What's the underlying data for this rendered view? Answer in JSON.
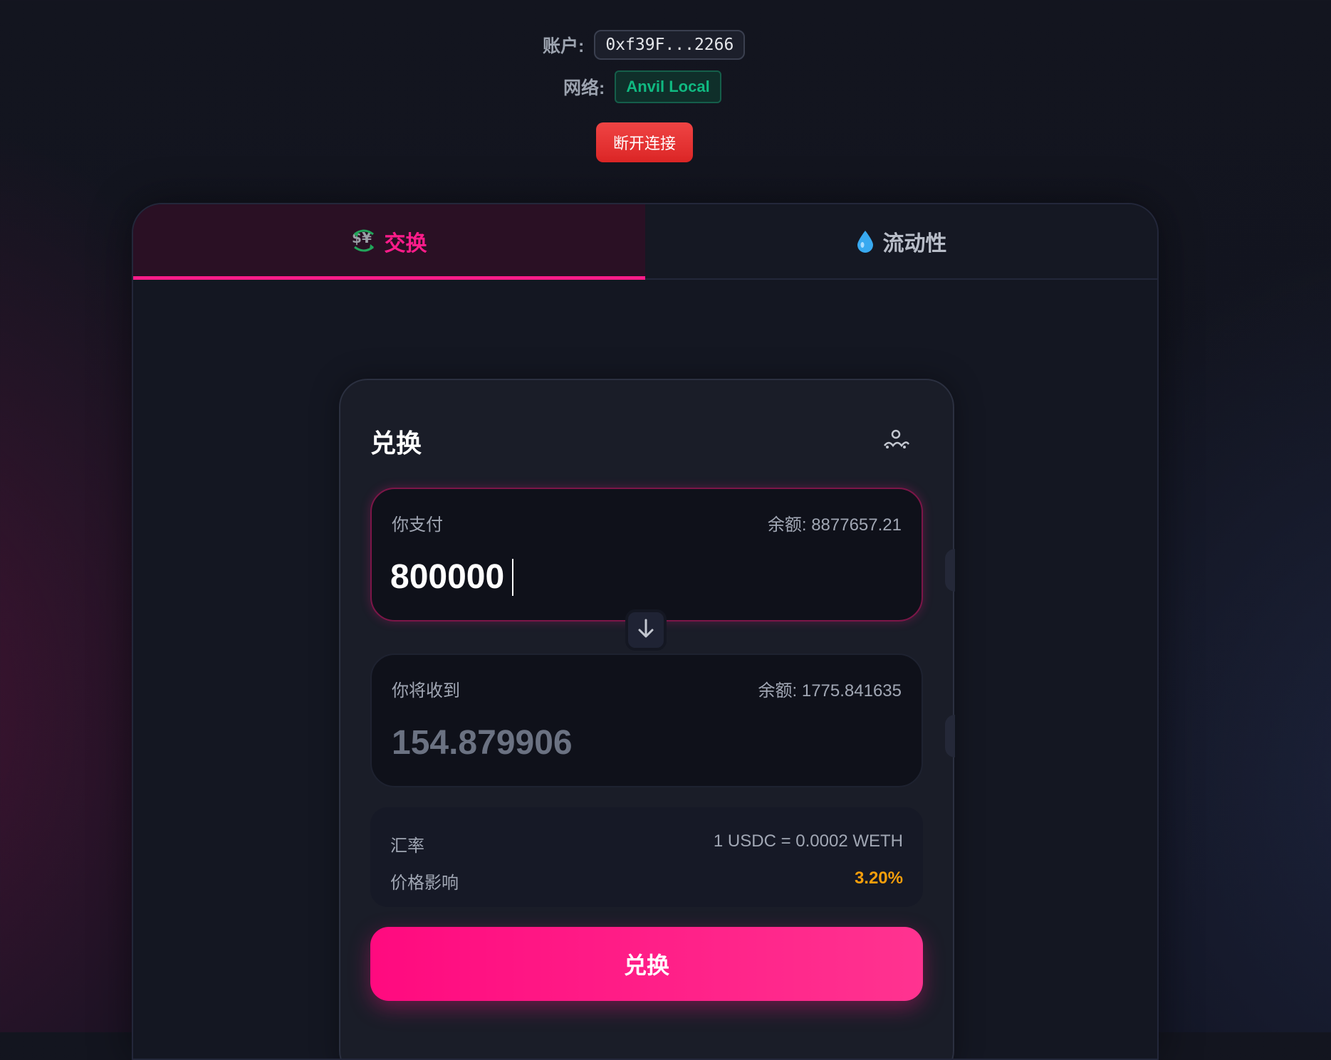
{
  "header": {
    "account_label": "账户:",
    "account_address": "0xf39F...2266",
    "network_label": "网络:",
    "network_name": "Anvil Local",
    "disconnect_label": "断开连接"
  },
  "tabs": [
    {
      "icon": "currency-exchange-icon",
      "label": "交换",
      "active": true
    },
    {
      "icon": "droplet-icon",
      "label": "流动性",
      "active": false
    }
  ],
  "swap": {
    "title": "兑换",
    "settings_icon": "settings-sliders-icon",
    "pay": {
      "label": "你支付",
      "balance": "余额: 8877657.21",
      "amount": "800000"
    },
    "receive": {
      "label": "你将收到",
      "balance": "余额: 1775.841635",
      "amount": "154.879906"
    },
    "flip_icon": "arrow-down-icon",
    "info": {
      "rate_label": "汇率",
      "rate_value": "1 USDC = 0.0002 WETH",
      "impact_label": "价格影响",
      "impact_value": "3.20%"
    },
    "submit_label": "兑换"
  },
  "colors": {
    "accent": "#ff1c8a",
    "network_green": "#10b981",
    "impact_orange": "#f59e0b",
    "disconnect_red": "#ef4444"
  }
}
